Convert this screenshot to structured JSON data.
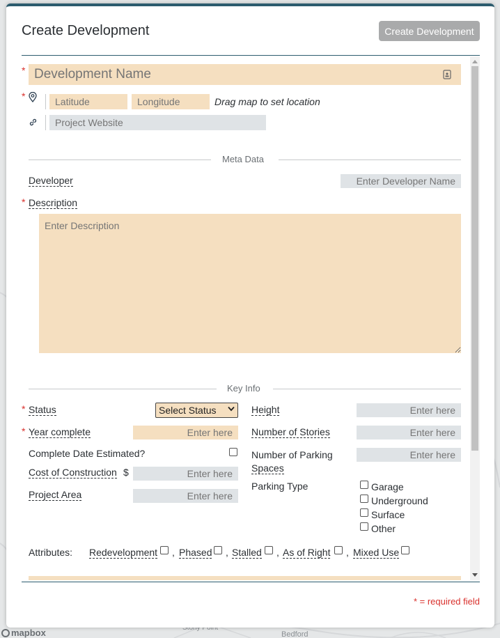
{
  "modal": {
    "title": "Create Development",
    "create_button": "Create Development",
    "required_note": "* = required field"
  },
  "form": {
    "required_mark": "*",
    "development_name_placeholder": "Development Name",
    "latitude_placeholder": "Latitude",
    "longitude_placeholder": "Longitude",
    "location_hint": "Drag map to set location",
    "website_placeholder": "Project Website",
    "meta_section": "Meta Data",
    "developer_label": "Developer",
    "developer_placeholder": "Enter Developer Name",
    "description_label": "Description",
    "description_placeholder": "Enter Description",
    "key_info_section": "Key Info",
    "status_label": "Status",
    "status_value": "Select Status",
    "year_complete_label": "Year complete",
    "year_complete_placeholder": "Enter here",
    "complete_date_estimated_label": "Complete Date Estimated?",
    "cost_label": "Cost of Construction",
    "currency_symbol": "$",
    "cost_placeholder": "Enter here",
    "project_area_label": "Project Area",
    "project_area_placeholder": "Enter here",
    "height_label": "Height",
    "height_placeholder": "Enter here",
    "stories_label": "Number of Stories",
    "stories_placeholder": "Enter here",
    "parking_spaces_label_line1": "Number of Parking",
    "parking_spaces_label_line2": "Spaces",
    "parking_spaces_placeholder": "Enter here",
    "parking_type_label": "Parking Type",
    "parking_types": [
      "Garage",
      "Underground",
      "Surface",
      "Other"
    ],
    "attributes_label": "Attributes:",
    "attributes": [
      "Redevelopment",
      "Phased",
      "Stalled",
      "As of Right",
      "Mixed Use"
    ],
    "attribute_separator": ","
  },
  "map": {
    "logo_text": "mapbox",
    "place_labels": [
      "Stony Point",
      "Bedford"
    ]
  },
  "icons": {
    "location": "map-pin-icon",
    "link": "link-icon",
    "contact_card": "contact-card-icon"
  }
}
